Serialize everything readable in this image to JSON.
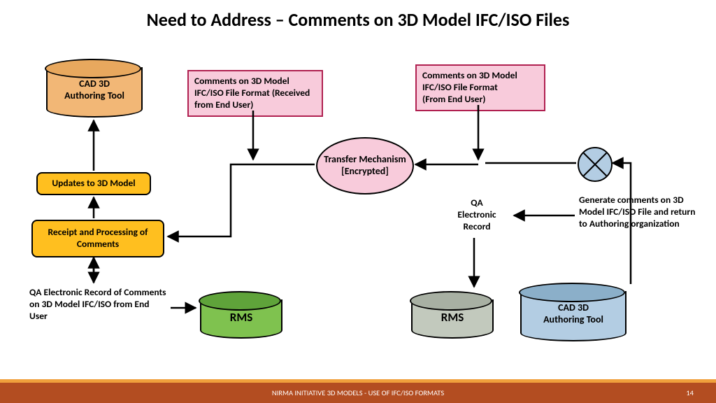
{
  "title": "Need to Address – Comments on 3D Model IFC/ISO Files",
  "cyl_cad_left": {
    "line1": "CAD 3D",
    "line2": "Authoring Tool"
  },
  "cyl_rms_green": "RMS",
  "cyl_rms_grey": "RMS",
  "cyl_cad_right": {
    "line1": "CAD 3D",
    "line2": "Authoring Tool"
  },
  "pink_box_left": "Comments on 3D Model IFC/ISO File Format (Received from End User)",
  "pink_box_right": "Comments on 3D Model IFC/ISO File Format\n(From End User)",
  "transfer": "Transfer Mechanism [Encrypted]",
  "updates_box": "Updates to 3D Model",
  "receipt_box": "Receipt and Processing of Comments",
  "qa_text_left": "QA Electronic Record of Comments on 3D Model IFC/ISO from End User",
  "qa_text_mid": "QA\nElectronic\nRecord",
  "gen_text": "Generate comments on 3D Model IFC/ISO File and return to Authoring organization",
  "footer_label": "NIRMA INITIATIVE  3D MODELS - USE OF IFC/ISO FORMATS",
  "footer_page": "14"
}
